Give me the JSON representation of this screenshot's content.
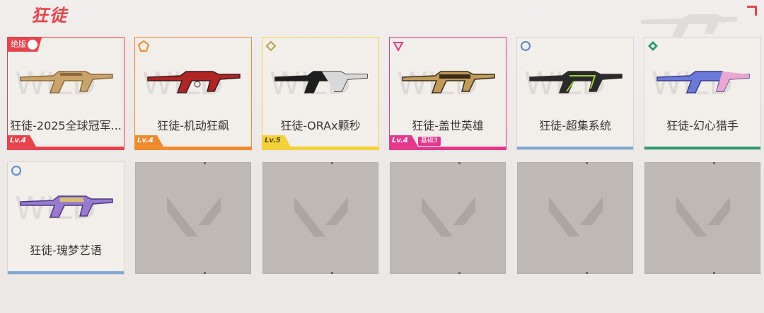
{
  "header": {
    "title": "狂徒"
  },
  "colors": {
    "accent": "#e8434b",
    "exclusive_red": "#e8434b",
    "orange": "#f08a2e",
    "yellow": "#f4d23a",
    "pink": "#e5388c",
    "blue": "#7fa8d8",
    "green": "#2e9a6e",
    "empty_slot": "#bfb9b6"
  },
  "skins": [
    {
      "name": "狂徒-2025全球冠军...",
      "badge": "绝版",
      "level": "Lv.4",
      "rarity_icon": "exclusive-icon",
      "border_color": "#e8434b",
      "bar_color": "#e8434b",
      "level_bg": "#e8434b",
      "gun_colors": [
        "#c9a46a",
        "#8a6a3c"
      ]
    },
    {
      "name": "狂徒-机动狂飙",
      "level": "Lv.4",
      "rarity_icon": "pentagon-icon",
      "border_color": "#f08a2e",
      "bar_color": "#f08a2e",
      "level_bg": "#f08a2e",
      "gun_colors": [
        "#b02424",
        "#3a1a1a"
      ]
    },
    {
      "name": "狂徒-ORAx颗秒",
      "level": "Lv.5",
      "rarity_icon": "diamond-icon",
      "border_color": "#f4d23a",
      "bar_color": "#f4d23a",
      "level_bg": "#f4d23a",
      "gun_colors": [
        "#1e1e1e",
        "#d8d8d8"
      ]
    },
    {
      "name": "狂徒-盖世英雄",
      "level": "Lv.4",
      "extra_tag": "基础3",
      "rarity_icon": "triangle-icon",
      "border_color": "#e5388c",
      "bar_color": "#e5388c",
      "level_bg": "#e5388c",
      "gun_colors": [
        "#c09a58",
        "#3a2a1a"
      ]
    },
    {
      "name": "狂徒-超集系统",
      "rarity_icon": "circle-icon",
      "border_color": "#d9d3cf",
      "bar_color": "#7fa8d8",
      "gun_colors": [
        "#2a2a2a",
        "#9ad238"
      ]
    },
    {
      "name": "狂徒-幻心猎手",
      "rarity_icon": "green-diamond-icon",
      "border_color": "#d9d3cf",
      "bar_color": "#2e9a6e",
      "gun_colors": [
        "#6a7ad8",
        "#e8a8d0"
      ]
    },
    {
      "name": "狂徒-瑰梦艺语",
      "rarity_icon": "circle-icon",
      "border_color": "#d9d3cf",
      "bar_color": "#7fa8d8",
      "gun_colors": [
        "#9a7ad0",
        "#d8c070"
      ]
    }
  ],
  "empty_slots": 5
}
